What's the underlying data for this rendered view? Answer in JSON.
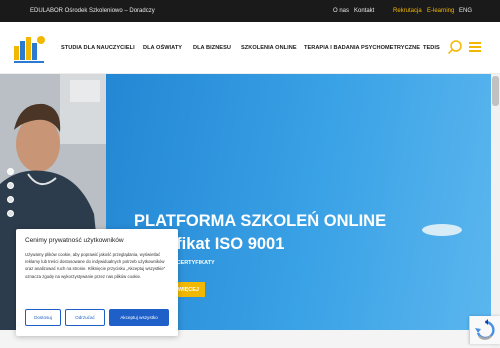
{
  "topbar": {
    "brand_text": "EDULABOR Ośrodek Szkoleniowo – Doradczy",
    "links": [
      "O nas",
      "Kontakt",
      "Rekrutacja",
      "E-learning",
      "ENG"
    ]
  },
  "nav": {
    "items": [
      "STUDIA DLA NAUCZYCIELI",
      "DLA OŚWIATY",
      "DLA BIZNESU",
      "SZKOLENIA ONLINE",
      "TERAPIA I BADANIA PSYCHOMETRYCZNE",
      "TEDIS"
    ]
  },
  "hero": {
    "title_line1": "PLATFORMA SZKOLEŃ ONLINE",
    "title_line2": "Certyfikat ISO 9001",
    "subtitle": "ŚWIADECTWA I CERTYFIKATY",
    "cta_label": "DOWIEDZ SIĘ WIĘCEJ"
  },
  "cookie": {
    "title": "Cenimy prywatność użytkowników",
    "text": "Używamy plików cookie, aby poprawić jakość przeglądania, wyświetlać reklamy lub treści dostosowane do indywidualnych potrzeb użytkowników oraz analizować ruch na stronie. Kliknięcie przycisku „Akceptuj wszystkie” oznacza zgodę na wykorzystywanie przez nas plików cookie.",
    "buttons": [
      "Dostosuj",
      "Odrzućać",
      "Akceptuj wszystko"
    ]
  },
  "colors": {
    "accent": "#f2b800",
    "hero_blue": "#2e95dd",
    "cookie_button": "#1e60c8",
    "topbar": "#1a1a1a"
  }
}
